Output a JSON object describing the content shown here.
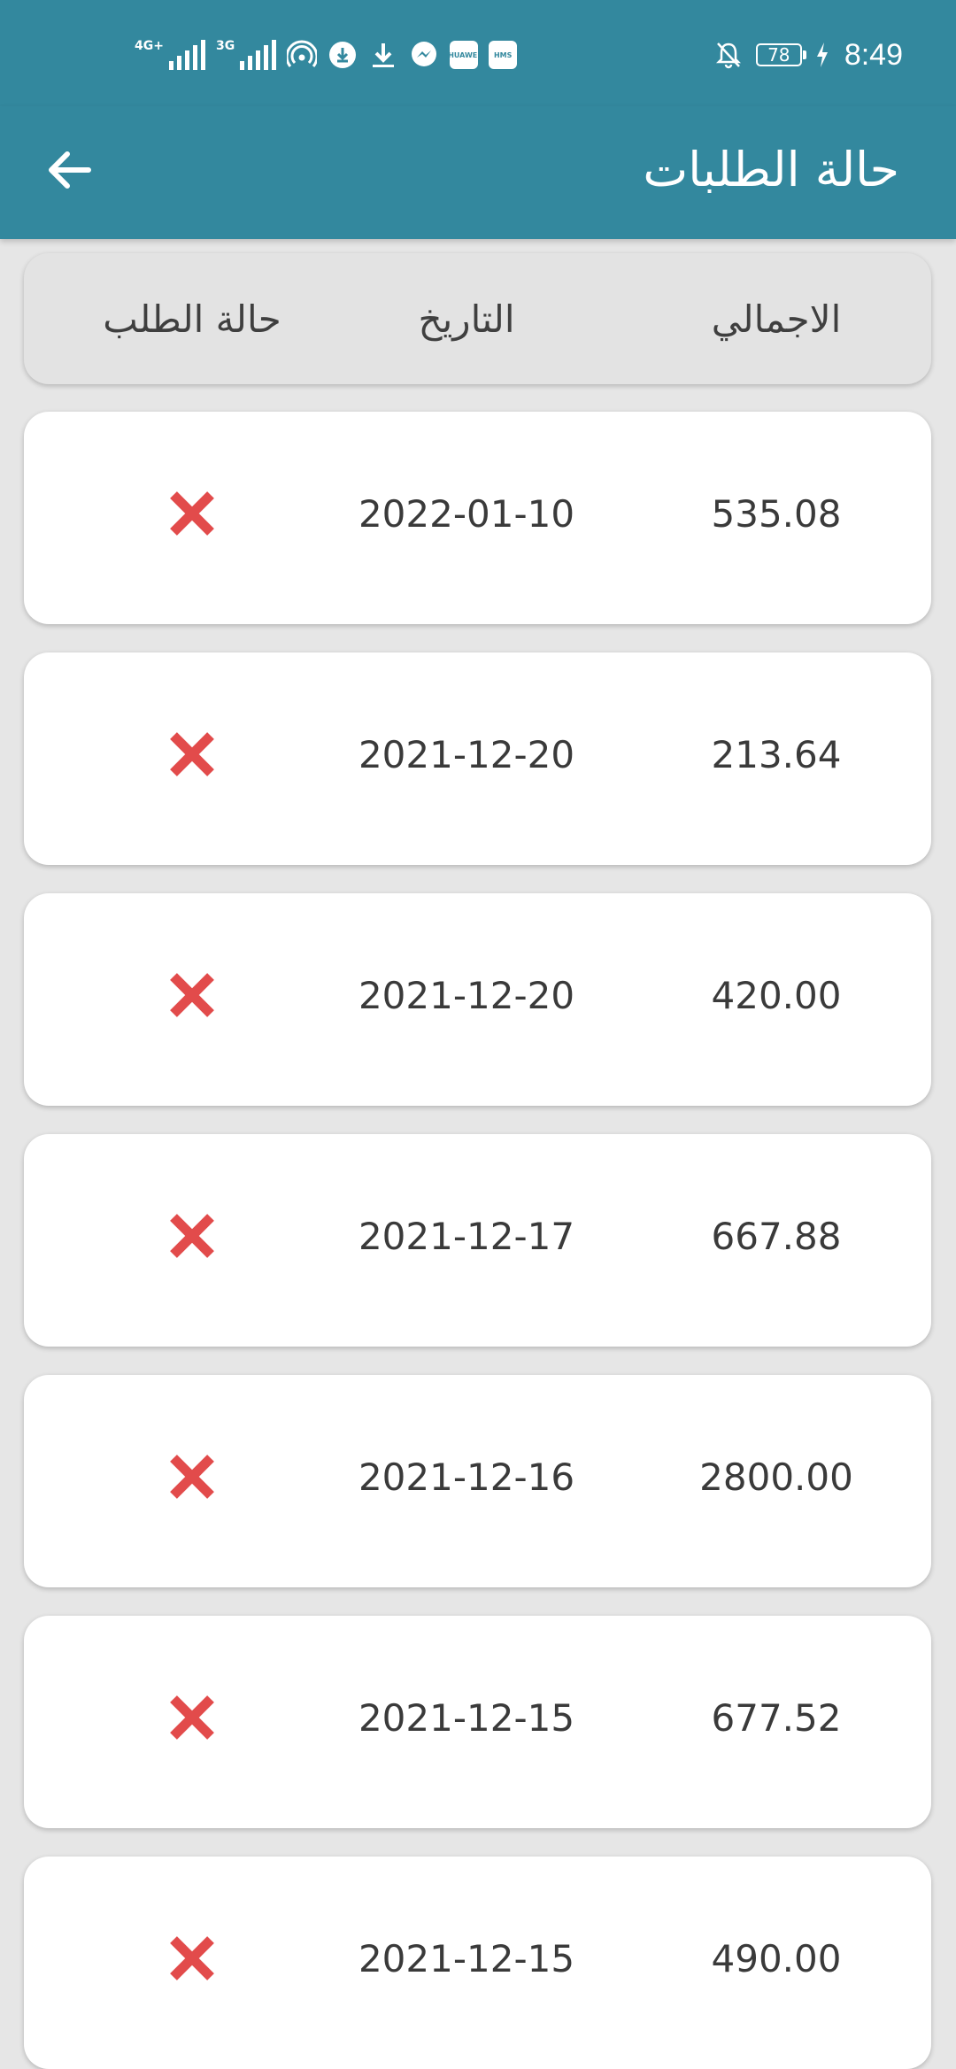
{
  "status_bar": {
    "network_1": "4G+",
    "network_2": "3G",
    "battery": "78",
    "time": "8:49",
    "icons": [
      "signal-icon",
      "signal-icon",
      "hotspot-icon",
      "download-manager-icon",
      "download-icon",
      "messenger-icon",
      "huawei-icon",
      "hms-icon",
      "bell-off-icon",
      "battery-icon",
      "charging-icon"
    ],
    "huawei_label": "HUAWEI",
    "hms_label": "HMS"
  },
  "app_bar": {
    "title": "حالة الطلبات",
    "back_icon": "arrow-left-icon"
  },
  "table": {
    "headers": {
      "total": "الاجمالي",
      "date": "التاريخ",
      "status": "حالة الطلب"
    },
    "rows": [
      {
        "total": "535.08",
        "date": "2022-01-10",
        "status_icon": "cancelled-x-icon"
      },
      {
        "total": "213.64",
        "date": "2021-12-20",
        "status_icon": "cancelled-x-icon"
      },
      {
        "total": "420.00",
        "date": "2021-12-20",
        "status_icon": "cancelled-x-icon"
      },
      {
        "total": "667.88",
        "date": "2021-12-17",
        "status_icon": "cancelled-x-icon"
      },
      {
        "total": "2800.00",
        "date": "2021-12-16",
        "status_icon": "cancelled-x-icon"
      },
      {
        "total": "677.52",
        "date": "2021-12-15",
        "status_icon": "cancelled-x-icon"
      },
      {
        "total": "490.00",
        "date": "2021-12-15",
        "status_icon": "cancelled-x-icon"
      }
    ]
  },
  "colors": {
    "primary": "#33889e",
    "background": "#e6e6e6",
    "card": "#ffffff",
    "header_card": "#e3e3e3",
    "cancel_red": "#e24b4b",
    "text": "#3a3a3a"
  }
}
